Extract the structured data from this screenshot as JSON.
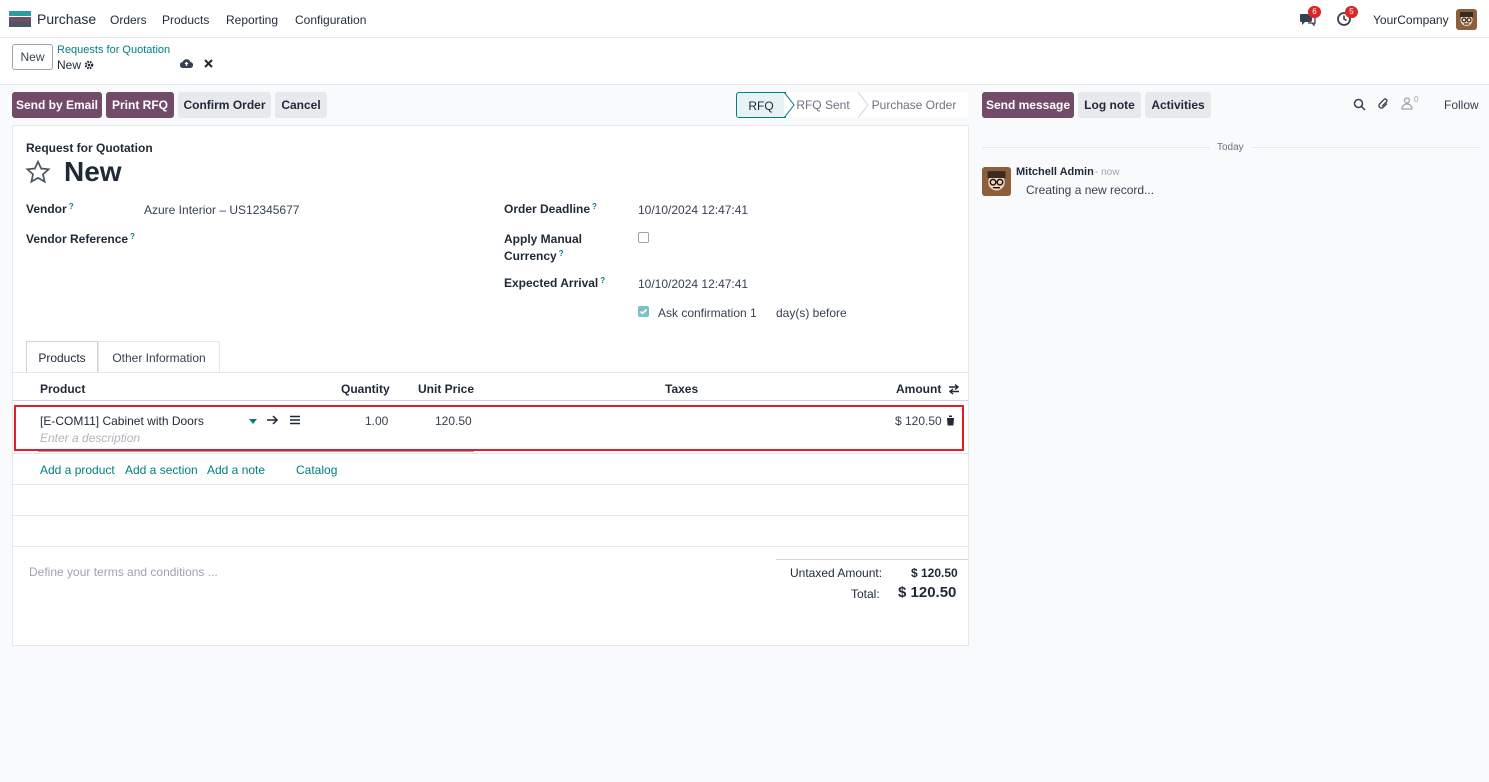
{
  "nav": {
    "app_name": "Purchase",
    "menu": [
      "Orders",
      "Products",
      "Reporting",
      "Configuration"
    ],
    "messages_badge": "6",
    "activities_badge": "5",
    "company": "YourCompany"
  },
  "control": {
    "new_label": "New",
    "breadcrumb_parent": "Requests for Quotation",
    "breadcrumb_current": "New"
  },
  "actions": {
    "send_by_email": "Send by Email",
    "print_rfq": "Print RFQ",
    "confirm_order": "Confirm Order",
    "cancel": "Cancel"
  },
  "statusbar": [
    "RFQ",
    "RFQ Sent",
    "Purchase Order"
  ],
  "form": {
    "doc_type": "Request for Quotation",
    "title": "New",
    "vendor_label": "Vendor",
    "vendor_value": "Azure Interior – US12345677",
    "vendor_ref_label": "Vendor Reference",
    "order_deadline_label": "Order Deadline",
    "order_deadline_value": "10/10/2024 12:47:41",
    "manual_currency_label_1": "Apply Manual",
    "manual_currency_label_2": "Currency",
    "expected_arrival_label": "Expected Arrival",
    "expected_arrival_value": "10/10/2024 12:47:41",
    "ask_confirmation_label": "Ask confirmation",
    "ask_confirmation_days": "1",
    "days_before": "day(s) before",
    "help_mark": "?"
  },
  "tabs": [
    "Products",
    "Other Information"
  ],
  "lines": {
    "headers": {
      "product": "Product",
      "quantity": "Quantity",
      "unit_price": "Unit Price",
      "taxes": "Taxes",
      "amount": "Amount"
    },
    "row": {
      "product": "[E-COM11] Cabinet with Doors",
      "description_placeholder": "Enter a description",
      "quantity": "1.00",
      "unit_price": "120.50",
      "amount": "$ 120.50"
    },
    "add_product": "Add a product",
    "add_section": "Add a section",
    "add_note": "Add a note",
    "catalog": "Catalog"
  },
  "totals": {
    "terms_placeholder": "Define your terms and conditions ...",
    "untaxed_label": "Untaxed Amount:",
    "untaxed_value": "$ 120.50",
    "total_label": "Total:",
    "total_value": "$ 120.50"
  },
  "chatter": {
    "send_message": "Send message",
    "log_note": "Log note",
    "activities": "Activities",
    "followers_count": "0",
    "follow": "Follow",
    "date_separator": "Today",
    "author": "Mitchell Admin",
    "time": "- now",
    "message": "Creating a new record..."
  },
  "colors": {
    "brand": "#714b67",
    "accent": "#017e84",
    "highlight": "#e11d2a",
    "badge": "#dc2626"
  }
}
